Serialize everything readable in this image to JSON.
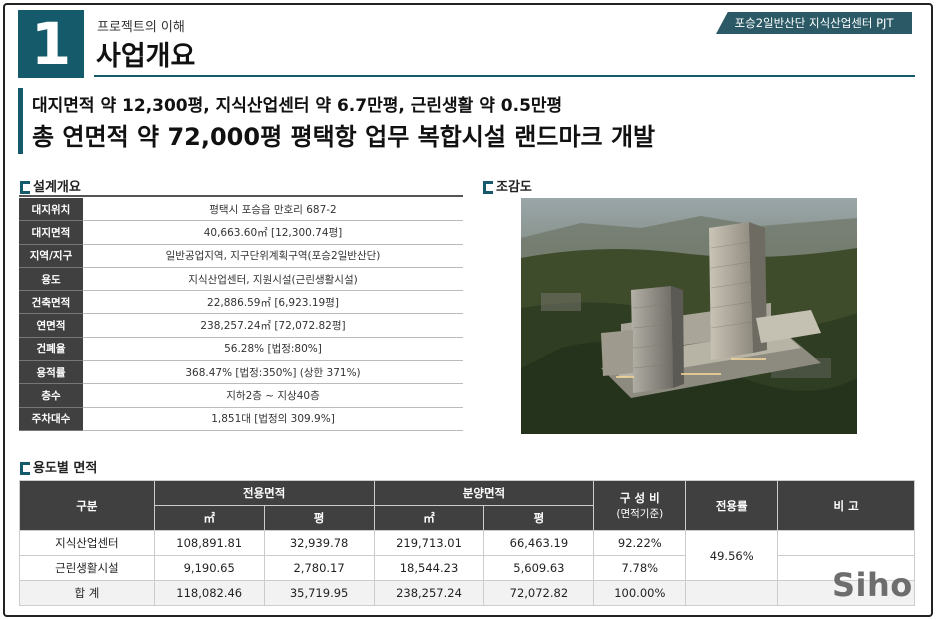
{
  "header": {
    "number": "1",
    "subtitle": "프로젝트의 이해",
    "title": "사업개요",
    "project_tag": "포승2일반산단 지식산업센터 PJT"
  },
  "headline": {
    "line1": "대지면적 약 12,300평, 지식산업센터 약 6.7만평, 근린생활 약 0.5만평",
    "line2": "총 연면적 약 72,000평 평택항 업무 복합시설 랜드마크 개발"
  },
  "overview": {
    "heading": "설계개요",
    "rows": [
      {
        "label": "대지위치",
        "value": "평택시 포승읍 만호리 687-2"
      },
      {
        "label": "대지면적",
        "value": "40,663.60㎡ [12,300.74평]"
      },
      {
        "label": "지역/지구",
        "value": "일반공업지역, 지구단위계획구역(포승2일반산단)"
      },
      {
        "label": "용도",
        "value": "지식산업센터, 지원시설(근린생활시설)"
      },
      {
        "label": "건축면적",
        "value": "22,886.59㎡ [6,923.19평]"
      },
      {
        "label": "연면적",
        "value": "238,257.24㎡ [72,072.82평]"
      },
      {
        "label": "건폐율",
        "value": "56.28% [법정:80%]"
      },
      {
        "label": "용적률",
        "value": "368.47% [법정:350%] (상한 371%)"
      },
      {
        "label": "층수",
        "value": "지하2층 ~ 지상40층"
      },
      {
        "label": "주차대수",
        "value": "1,851대 [법정의 309.9%]"
      }
    ]
  },
  "rendering": {
    "heading": "조감도"
  },
  "area_table": {
    "heading": "용도별 면적",
    "headers": {
      "category": "구분",
      "exclusive": "전용면적",
      "sale": "분양면적",
      "ratio": "구 성 비",
      "ratio_sub": "(면적기준)",
      "efficiency": "전용률",
      "remarks": "비 고",
      "unit_m2": "㎡",
      "unit_pyeong": "평"
    },
    "rows": [
      {
        "name": "지식산업센터",
        "ex_m2": "108,891.81",
        "ex_py": "32,939.78",
        "sale_m2": "219,713.01",
        "sale_py": "66,463.19",
        "ratio": "92.22%"
      },
      {
        "name": "근린생활시설",
        "ex_m2": "9,190.65",
        "ex_py": "2,780.17",
        "sale_m2": "18,544.23",
        "sale_py": "5,609.63",
        "ratio": "7.78%"
      }
    ],
    "efficiency_value": "49.56%",
    "total": {
      "name": "합 계",
      "ex_m2": "118,082.46",
      "ex_py": "35,719.95",
      "sale_m2": "238,257.24",
      "sale_py": "72,072.82",
      "ratio": "100.00%"
    }
  },
  "watermark": "Siho",
  "colors": {
    "accent": "#145a6a",
    "table_header": "#404040"
  }
}
